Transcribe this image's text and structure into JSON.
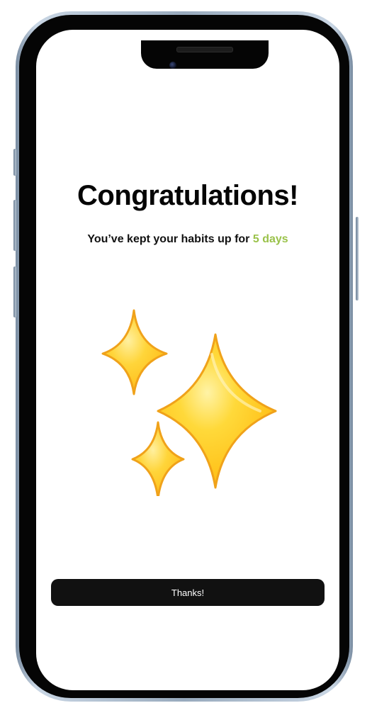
{
  "screen": {
    "title": "Congratulations!",
    "subtitle_prefix": "You’ve kept your habits up for ",
    "streak_text": "5 days",
    "sparkles_icon": "sparkles-emoji-icon",
    "button_label": "Thanks!"
  },
  "colors": {
    "accent_green": "#9ac24a",
    "button_background": "#111111",
    "button_text": "#ffffff",
    "sparkle_yellow": "#ffd233",
    "sparkle_orange": "#f2a11c"
  }
}
